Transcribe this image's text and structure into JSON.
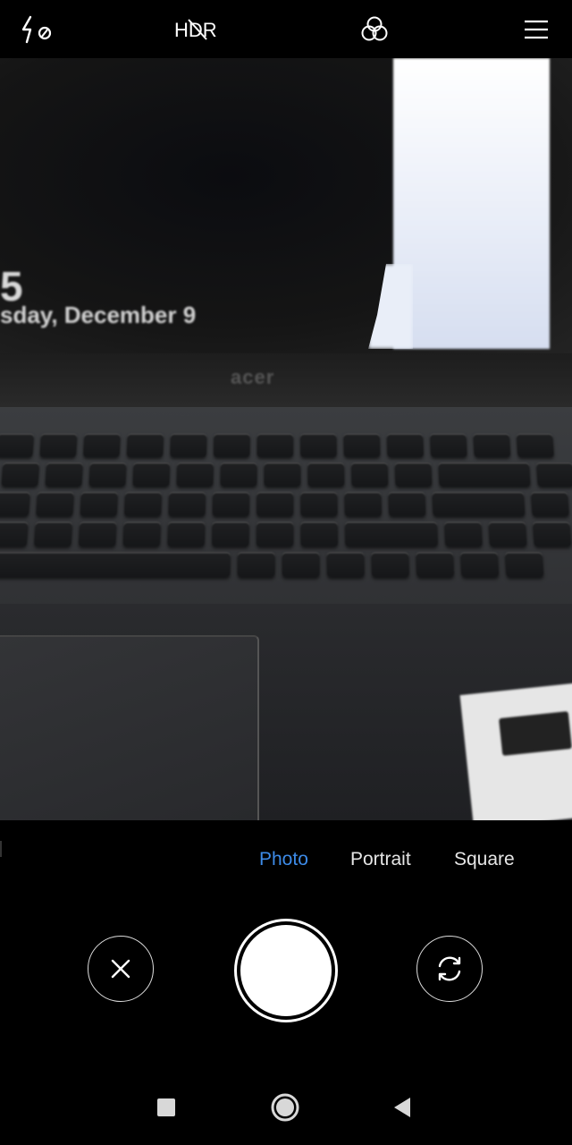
{
  "topbar": {
    "flash_icon": "flash-off-icon",
    "hdr_label": "HDR",
    "filters_icon": "filters-icon",
    "menu_icon": "menu-icon"
  },
  "viewfinder": {
    "lock_time": "5",
    "lock_date": "sday, December 9",
    "brand": "acer"
  },
  "modes": {
    "items": [
      "Photo",
      "Portrait",
      "Square"
    ],
    "active": "Photo",
    "active_color": "#3d8be8"
  },
  "controls": {
    "cancel_icon": "close-icon",
    "shutter_icon": "shutter-button",
    "switch_icon": "camera-switch-icon"
  },
  "navbar": {
    "recents_icon": "recents-icon",
    "home_icon": "home-icon",
    "back_icon": "back-icon"
  }
}
